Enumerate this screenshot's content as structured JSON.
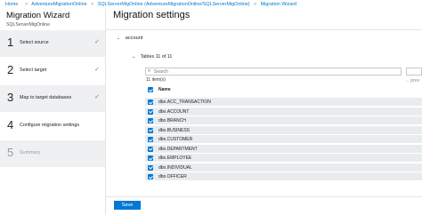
{
  "breadcrumb": {
    "home": "Home",
    "items": [
      "AdventureMigrationOnline",
      "SQLServerMigOnline (AdventureMigrationOnline/SQLServerMigOnline)",
      "Migration Wizard"
    ]
  },
  "wizard": {
    "title": "Migration Wizard",
    "subtitle": "SQLServerMigOnline",
    "steps": [
      {
        "num": "1",
        "label": "Select source",
        "done": true
      },
      {
        "num": "2",
        "label": "Select target",
        "done": true
      },
      {
        "num": "3",
        "label": "Map to target databases",
        "done": true
      },
      {
        "num": "4",
        "label": "Configure migration settings",
        "done": false
      },
      {
        "num": "5",
        "label": "Summary",
        "done": false
      }
    ],
    "check_glyph": "✓"
  },
  "main": {
    "title": "Migration settings",
    "account_label": "account",
    "tables_label": "Tables 11 of 11",
    "search_placeholder": "Search",
    "count_label": "11 item(s)",
    "prev_label": "← prev",
    "column_header": "Name",
    "rows": [
      "dbo.ACC_TRANSACTION",
      "dbo.ACCOUNT",
      "dbo.BRANCH",
      "dbo.BUSINESS",
      "dbo.CUSTOMER",
      "dbo.DEPARTMENT",
      "dbo.EMPLOYEE",
      "dbo.INDIVIDUAL",
      "dbo.OFFICER"
    ],
    "save_label": "Save"
  },
  "colors": {
    "accent": "#0078d4",
    "row_bg": "#e9ecef",
    "check": "#7a8a2a"
  }
}
